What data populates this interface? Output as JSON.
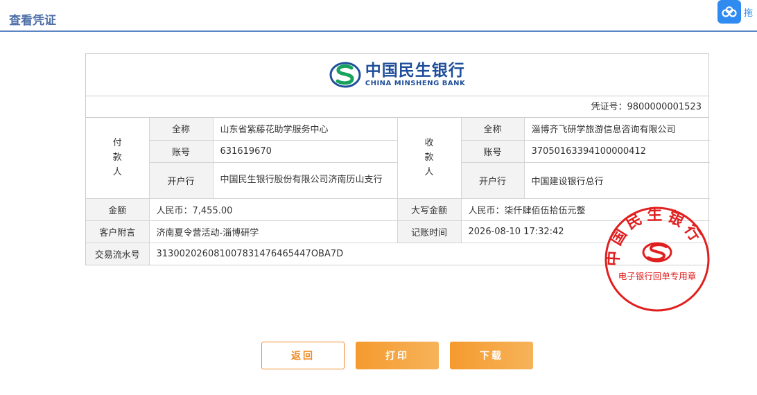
{
  "header": {
    "title": "查看凭证"
  },
  "float_widget": {
    "label": "拖"
  },
  "bank": {
    "name_cn": "中国民生银行",
    "name_en": "CHINA MINSHENG BANK",
    "brand_color": "#1f4e9a"
  },
  "voucher": {
    "number_label": "凭证号：",
    "number": "9800000001523",
    "payer": {
      "side_chars": [
        "付",
        "款",
        "人"
      ],
      "name_label": "全称",
      "name": "山东省紫藤花助学服务中心",
      "account_label": "账号",
      "account": "631619670",
      "bank_label": "开户行",
      "bank": "中国民生银行股份有限公司济南历山支行"
    },
    "payee": {
      "side_chars": [
        "收",
        "款",
        "人"
      ],
      "name_label": "全称",
      "name": "淄博齐飞研学旅游信息咨询有限公司",
      "account_label": "账号",
      "account": "37050163394100000412",
      "bank_label": "开户行",
      "bank": "中国建设银行总行"
    },
    "amount_label": "金额",
    "amount": "人民币：7,455.00",
    "amount_upper_label": "大写金额",
    "amount_upper": "人民币：柒仟肆佰伍拾伍元整",
    "memo_label": "客户附言",
    "memo": "济南夏令营活动-淄博研学",
    "posting_time_label": "记账时间",
    "posting_time": "2026-08-10 17:32:42",
    "serial_label": "交易流水号",
    "serial": "313002026081007831476465447OBA7D"
  },
  "seal": {
    "arc_text": "中国民生银行",
    "bottom_text": "电子银行回单专用章",
    "color": "#e02020"
  },
  "buttons": {
    "back": "返回",
    "print": "打印",
    "download": "下载"
  }
}
